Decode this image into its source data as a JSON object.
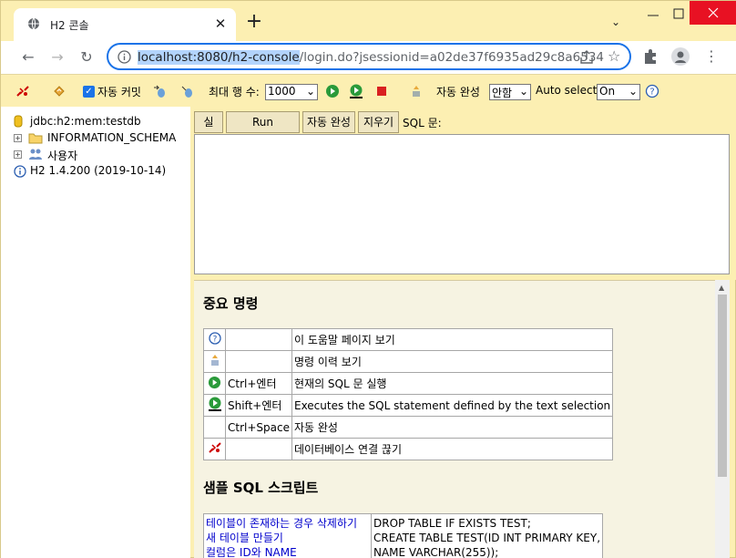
{
  "browser": {
    "tab_title": "H2 콘솔",
    "url_selected": "localhost:8080/h2-console",
    "url_rest": "/login.do?jsessionid=a02de37f6935ad29c8a6534"
  },
  "toolbar": {
    "autocommit_label": "자동 커밋",
    "max_rows_label": "최대 행 수:",
    "max_rows_value": "1000",
    "autocomplete_label": "자동 완성",
    "autocomplete_value": "안함",
    "autoselect_label": "Auto select",
    "autoselect_value": "On"
  },
  "tree": {
    "items": [
      {
        "label": "jdbc:h2:mem:testdb"
      },
      {
        "label": "INFORMATION_SCHEMA"
      },
      {
        "label": "사용자"
      },
      {
        "label": "H2 1.4.200 (2019-10-14)"
      }
    ]
  },
  "query": {
    "run_label": "실행",
    "run_selected_label": "Run Selected",
    "autocomplete_label": "자동 완성",
    "clear_label": "지우기",
    "sql_label": "SQL 문:"
  },
  "help": {
    "important_title": "중요 명령",
    "rows": [
      {
        "key": "",
        "desc": "이 도움말 페이지 보기"
      },
      {
        "key": "",
        "desc": "명령 이력 보기"
      },
      {
        "key": "Ctrl+엔터",
        "desc": "현재의 SQL 문 실행"
      },
      {
        "key": "Shift+엔터",
        "desc": "Executes the SQL statement defined by the text selection"
      },
      {
        "key": "Ctrl+Space",
        "desc": "자동 완성"
      },
      {
        "key": "",
        "desc": "데이터베이스 연결 끊기"
      }
    ],
    "sample_title": "샘플 SQL 스크립트",
    "sample_links": [
      "테이블이 존재하는 경우 삭제하기",
      "새 테이블 만들기",
      "컬럼은 ID와 NAME"
    ],
    "sample_code": [
      "DROP TABLE IF EXISTS TEST;",
      "CREATE TABLE TEST(ID INT PRIMARY KEY,",
      "   NAME VARCHAR(255));"
    ]
  }
}
